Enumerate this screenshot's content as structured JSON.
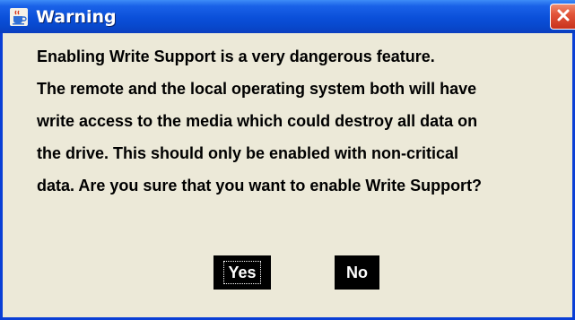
{
  "window": {
    "title": "Warning",
    "icon": "java-cup-icon",
    "close_icon": "close-x-icon",
    "colors": {
      "titlebar": "#0a4fd9",
      "body": "#ece9d8",
      "close": "#e2553a"
    }
  },
  "message": {
    "lines": [
      "Enabling Write Support is a very dangerous feature.",
      "The remote and the local operating system both will have",
      "write access to the media which could destroy all data on",
      "the drive. This should only be enabled with non-critical",
      "data. Are you sure that you want to enable Write Support?"
    ]
  },
  "buttons": {
    "yes_label": "Yes",
    "no_label": "No"
  }
}
